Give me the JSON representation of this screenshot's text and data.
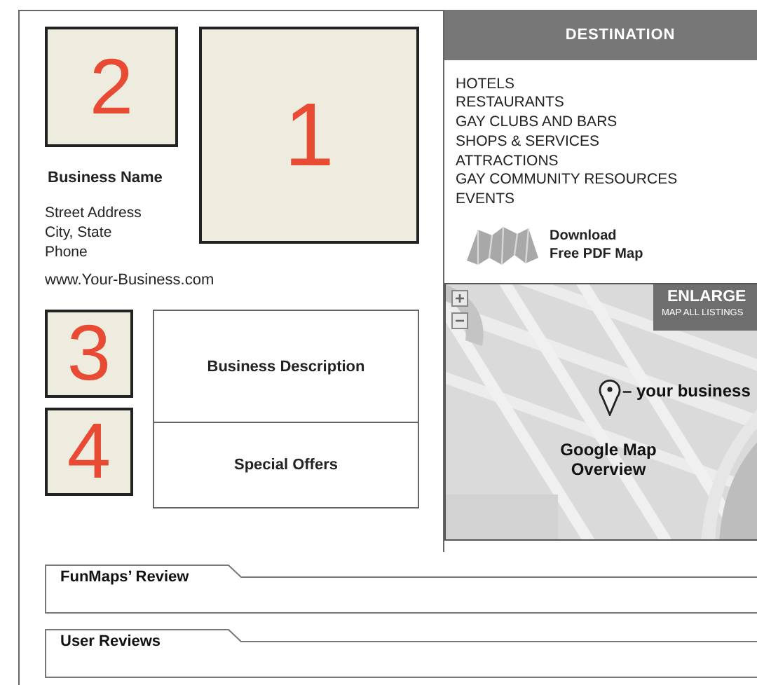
{
  "number_boxes": [
    {
      "number": "2"
    },
    {
      "number": "1"
    },
    {
      "number": "3"
    },
    {
      "number": "4"
    }
  ],
  "business": {
    "name": "Business Name",
    "address_lines": [
      "Street Address",
      "City, State",
      "Phone"
    ],
    "website": "www.Your-Business.com"
  },
  "info_box": {
    "sections": [
      "Business Description",
      "Special Offers"
    ]
  },
  "destination": {
    "title": "DESTINATION",
    "categories": [
      "HOTELS",
      "RESTAURANTS",
      "GAY CLUBS AND BARS",
      "SHOPS & SERVICES",
      "ATTRACTIONS",
      "GAY COMMUNITY RESOURCES",
      "EVENTS"
    ],
    "download_lines": [
      "Download",
      "Free PDF Map"
    ]
  },
  "map": {
    "enlarge": "ENLARGE",
    "enlarge_sub": "MAP ALL LISTINGS",
    "marker_label": "– your business",
    "caption_lines": [
      "Google Map",
      "Overview"
    ]
  },
  "sections": [
    "FunMaps’ Review",
    "User Reviews"
  ]
}
